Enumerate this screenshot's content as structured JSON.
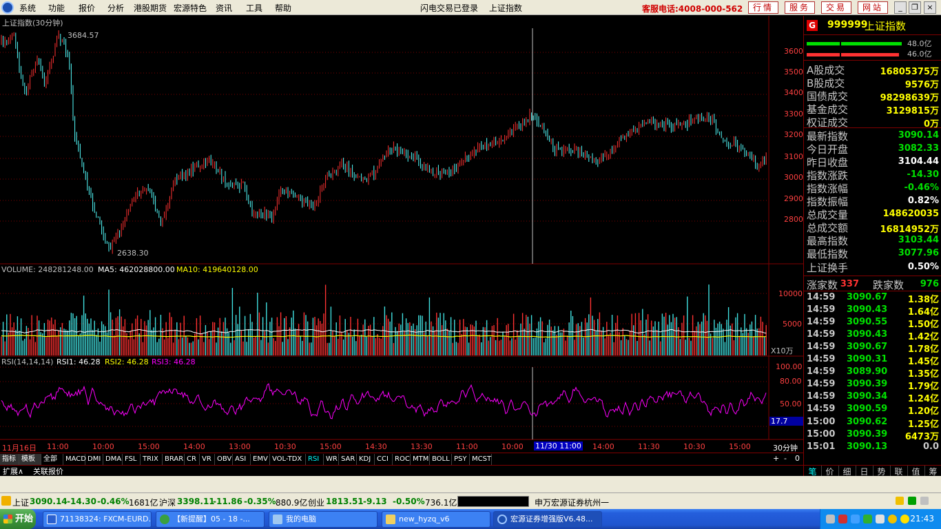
{
  "menu": {
    "items": [
      "系统",
      "功能",
      "报价",
      "分析",
      "港股期货",
      "宏源特色",
      "资讯",
      "工具",
      "帮助"
    ],
    "center": [
      "闪电交易已登录",
      "上证指数"
    ],
    "hotline": "客服电话:4008-000-562",
    "quick_buttons": [
      "行情",
      "服务",
      "交易",
      "网站"
    ],
    "window_controls": [
      "_",
      "❐",
      "×"
    ]
  },
  "chart": {
    "title": "上证指数(30分钟)",
    "high_label": "3684.57",
    "low_label": "2638.30",
    "price_ticks": [
      "3600",
      "3500",
      "3400",
      "3300",
      "3200",
      "3100",
      "3000",
      "2900",
      "2800"
    ],
    "volume": {
      "label": "VOLUME: 248281248.00",
      "ma5": "MA5: 462028800.00",
      "ma10": "MA10: 419640128.00",
      "ticks": [
        "10000",
        "5000"
      ],
      "unit": "X10万"
    },
    "rsi": {
      "label": "RSI(14,14,14)",
      "rsi1": "RSI1: 46.28",
      "rsi2": "RSI2: 46.28",
      "rsi3": "RSI3: 46.28",
      "ticks": [
        "100.00",
        "80.00",
        "50.00",
        "20.00"
      ],
      "current": "17.7"
    },
    "time_axis": [
      "11月16日",
      "11:00",
      "10:00",
      "15:00",
      "14:00",
      "13:00",
      "10:30",
      "15:00",
      "14:30",
      "13:30",
      "11:00",
      "10:00",
      "11/30 11:00",
      "14:00",
      "11:30",
      "10:30",
      "15:00"
    ],
    "period": "30分钟",
    "colors": {
      "up": "#ff3232",
      "down": "#54ffff",
      "ma5": "#ffffff",
      "ma10": "#ffff00",
      "rsi": "#ff00ff",
      "grid": "#800000"
    }
  },
  "indicators": {
    "tabs": [
      "指标",
      "模板",
      "全部",
      "MACD",
      "DMI",
      "DMA",
      "FSL",
      "TRIX",
      "BRAR",
      "CR",
      "VR",
      "OBV",
      "ASI",
      "EMV",
      "VOL-TDX",
      "RSI",
      "WR",
      "SAR",
      "KDJ",
      "CCI",
      "ROC",
      "MTM",
      "BOLL",
      "PSY",
      "MCST"
    ],
    "active": "RSI",
    "controls": [
      "+",
      "-",
      "0"
    ],
    "ext": [
      "扩展∧",
      "关联报价"
    ]
  },
  "panel": {
    "code": "999999",
    "name": "上证指数",
    "g_badge": "G",
    "bar_top_value": "48.0亿",
    "bar_bottom_value": "46.0亿",
    "stats": [
      {
        "label": "A股成交",
        "value": "16805375万",
        "color": "#ffff00"
      },
      {
        "label": "B股成交",
        "value": "9576万",
        "color": "#ffff00"
      },
      {
        "label": "国债成交",
        "value": "98298639万",
        "color": "#ffff00"
      },
      {
        "label": "基金成交",
        "value": "3129815万",
        "color": "#ffff00"
      },
      {
        "label": "权证成交",
        "value": "0万",
        "color": "#ffff00"
      },
      {
        "label": "最新指数",
        "value": "3090.14",
        "color": "#00e000"
      },
      {
        "label": "今日开盘",
        "value": "3082.33",
        "color": "#00e000"
      },
      {
        "label": "昨日收盘",
        "value": "3104.44",
        "color": "#ffffff"
      },
      {
        "label": "指数涨跌",
        "value": "-14.30",
        "color": "#00e000"
      },
      {
        "label": "指数涨幅",
        "value": "-0.46%",
        "color": "#00e000"
      },
      {
        "label": "指数振幅",
        "value": "0.82%",
        "color": "#ffffff"
      },
      {
        "label": "总成交量",
        "value": "148620035",
        "color": "#ffff00"
      },
      {
        "label": "总成交额",
        "value": "16814952万",
        "color": "#ffff00"
      },
      {
        "label": "最高指数",
        "value": "3103.44",
        "color": "#00e000"
      },
      {
        "label": "最低指数",
        "value": "3077.96",
        "color": "#00e000"
      },
      {
        "label": "上证换手",
        "value": "0.50%",
        "color": "#ffffff"
      }
    ],
    "up_label": "涨家数",
    "up_count": "337",
    "down_label": "跌家数",
    "down_count": "976",
    "ticks": [
      {
        "time": "14:59",
        "price": "3090.67",
        "vol": "1.38亿"
      },
      {
        "time": "14:59",
        "price": "3090.43",
        "vol": "1.64亿"
      },
      {
        "time": "14:59",
        "price": "3090.55",
        "vol": "1.50亿"
      },
      {
        "time": "14:59",
        "price": "3090.43",
        "vol": "1.42亿"
      },
      {
        "time": "14:59",
        "price": "3090.67",
        "vol": "1.78亿"
      },
      {
        "time": "14:59",
        "price": "3090.31",
        "vol": "1.45亿"
      },
      {
        "time": "14:59",
        "price": "3089.90",
        "vol": "1.35亿"
      },
      {
        "time": "14:59",
        "price": "3090.39",
        "vol": "1.79亿"
      },
      {
        "time": "14:59",
        "price": "3090.34",
        "vol": "1.24亿"
      },
      {
        "time": "14:59",
        "price": "3090.59",
        "vol": "1.20亿"
      },
      {
        "time": "15:00",
        "price": "3090.62",
        "vol": "1.25亿"
      },
      {
        "time": "15:00",
        "price": "3090.39",
        "vol": "6473万"
      },
      {
        "time": "15:01",
        "price": "3090.13",
        "vol": "0.0"
      }
    ],
    "tabs": [
      "笔",
      "价",
      "细",
      "日",
      "势",
      "联",
      "值",
      "筹"
    ]
  },
  "status": {
    "sh_label": "上证",
    "sh_index": "3090.14",
    "sh_change": "-14.30",
    "sh_pct": "-0.46%",
    "sh_amount": "1681亿",
    "sz_label": "沪深",
    "sz_index": "3398.11",
    "sz_change": "-11.86",
    "sz_pct": "-0.35%",
    "sz_amount": "880.9亿",
    "cy_label": "创业",
    "cy_index": "1813.51",
    "cy_change": "-9.13",
    "cy_pct": "-0.50%",
    "cy_amount": "736.1亿",
    "broker": "申万宏源证券杭州一"
  },
  "taskbar": {
    "start": "开始",
    "tasks": [
      "71138324: FXCM-EURD...",
      "【新提醒】05 - 18 -...",
      "我的电脑",
      "new_hyzq_v6",
      "宏源证券增强版V6.48..."
    ],
    "clock": "21:43"
  }
}
